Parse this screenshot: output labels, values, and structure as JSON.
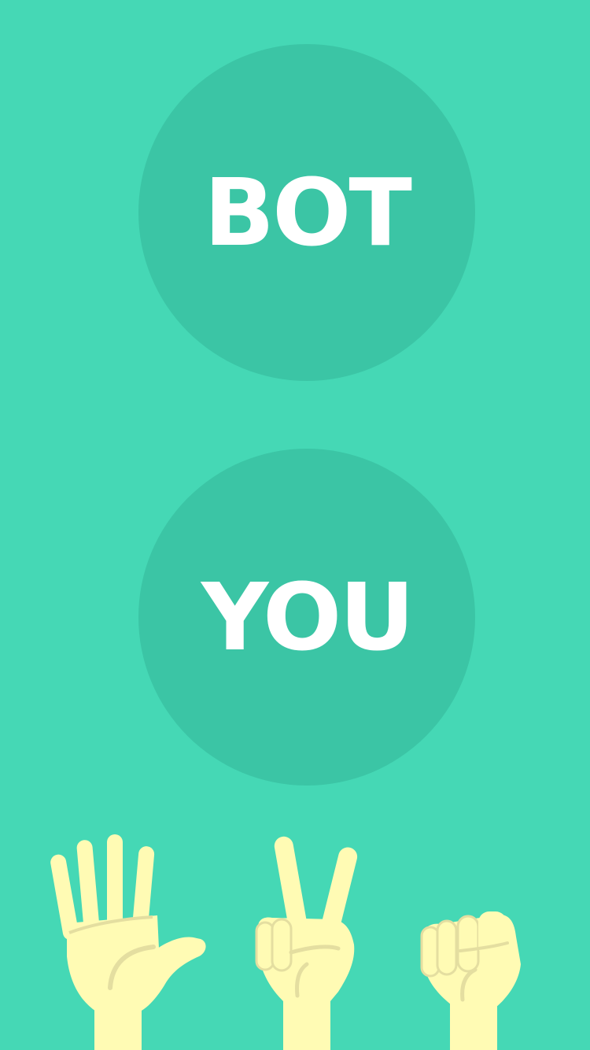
{
  "bot": {
    "label": "BOT"
  },
  "player": {
    "label": "YOU"
  },
  "choices": [
    {
      "icon": "hand-paper-icon"
    },
    {
      "icon": "hand-scissors-icon"
    },
    {
      "icon": "hand-rock-icon"
    }
  ],
  "colors": {
    "background": "#45d8b5",
    "circle": "#3bc5a5",
    "text": "#ffffff",
    "hand": "#fffbb4",
    "hand_shadow": "#e4dea0"
  }
}
